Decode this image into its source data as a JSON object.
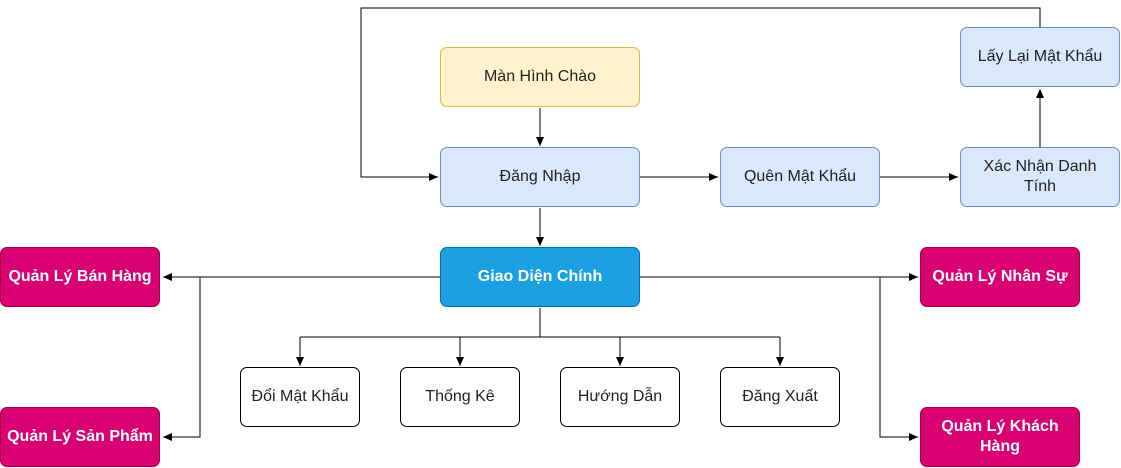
{
  "nodes": {
    "splash": "Màn Hình Chào",
    "login": "Đăng Nhập",
    "forgot": "Quên Mật Khẩu",
    "verify": "Xác Nhận Danh Tính",
    "recover": "Lấy Lại Mật Khẩu",
    "main": "Giao Diện Chính",
    "sales": "Quản Lý Bán Hàng",
    "products": "Quản Lý Sản Phẩm",
    "staff": "Quản Lý Nhân Sự",
    "customers": "Quản Lý Khách Hàng",
    "change_password": "Đổi Mật Khẩu",
    "stats": "Thống Kê",
    "guide": "Hướng Dẫn",
    "logout": "Đăng Xuất"
  },
  "colors": {
    "yellow_fill": "#fff2cc",
    "blue_fill": "#dae8fc",
    "main_fill": "#1ba1e2",
    "pink_fill": "#d80073",
    "edge": "#000000"
  }
}
